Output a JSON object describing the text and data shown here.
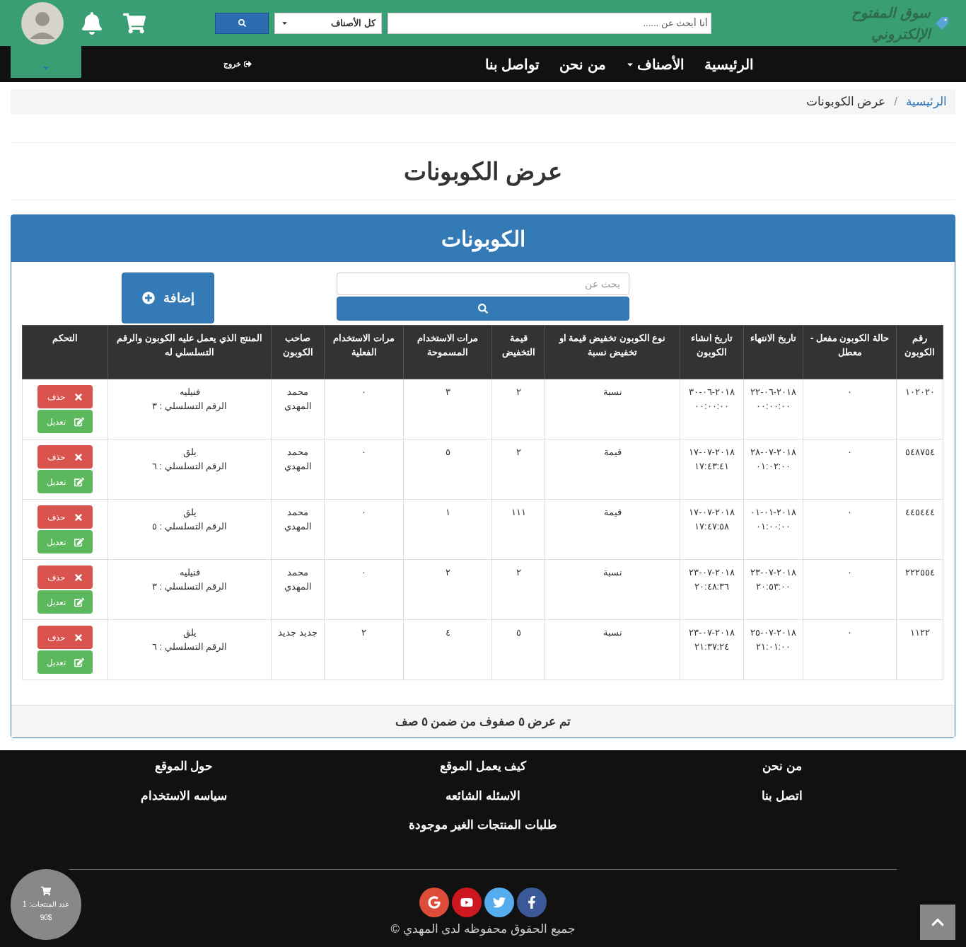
{
  "header": {
    "logo": "سوق المفتوح الإلكتروني",
    "search": {
      "placeholder": "أنا أبحث عن ......"
    },
    "category_select": {
      "value": "كل الأصناف"
    }
  },
  "nav": {
    "items": [
      {
        "label": "الرئيسية",
        "dropdown": false
      },
      {
        "label": "الأصناف",
        "dropdown": true
      },
      {
        "label": "من نحن",
        "dropdown": false
      },
      {
        "label": "تواصل بنا",
        "dropdown": false
      }
    ],
    "logout": "خروج"
  },
  "breadcrumb_separator": "/",
  "breadcrumb": [
    {
      "label": "الرئيسية",
      "selected": false
    },
    {
      "label": "عرض الكوبونات",
      "selected": true
    }
  ],
  "page_title": "عرض الكوبونات",
  "panel": {
    "title": "الكوبونات",
    "search": {
      "placeholder": "بحث عن"
    },
    "add_button": "إضافة",
    "table": {
      "columns": [
        "رقم الكوبون",
        "حالة الكوبون مفعل - معطل",
        "تاريخ الانتهاء",
        "تاريخ انشاء الكوبون",
        "نوع الكوبون تخفيض قيمة او تخفيض نسبة",
        "قيمة التخفيض",
        "مرات الاستخدام المسموحة",
        "مرات الاستخدام الفعلية",
        "صاحب الكوبون",
        "المنتج الذي يعمل عليه الكوبون والرقم التسلسلي له",
        "التحكم"
      ],
      "rows": [
        {
          "code": "١٠٢٠٢٠",
          "status": "٠",
          "expiry": [
            "٢٠١٨-٠٦-٢٢",
            "٠٠:٠٠:٠٠"
          ],
          "created": [
            "٢٠١٨-٠٦-٣٠",
            "٠٠:٠٠:٠٠"
          ],
          "type": "نسبة",
          "amount": "٢",
          "allowed": "٣",
          "used": "٠",
          "owner": "محمد المهدي",
          "product": [
            "فنيليه",
            "الرقم التسلسلي : ٣"
          ],
          "delete": "حذف",
          "edit": "تعديل"
        },
        {
          "code": "٥٤٨٧٥٤",
          "status": "٠",
          "expiry": [
            "٢٠١٨-٠٧-٢٨",
            "٠١:٠٢:٠٠"
          ],
          "created": [
            "٢٠١٨-٠٧-١٧",
            "١٧:٤٣:٤١"
          ],
          "type": "قيمة",
          "amount": "٢",
          "allowed": "٥",
          "used": "٠",
          "owner": "محمد المهدي",
          "product": [
            "يلق",
            "الرقم التسلسلي : ٦"
          ],
          "delete": "حذف",
          "edit": "تعديل"
        },
        {
          "code": "٤٤٥٤٤٤",
          "status": "٠",
          "expiry": [
            "٢٠١٨-٠١-٠١",
            "٠١:٠٠:٠٠"
          ],
          "created": [
            "٢٠١٨-٠٧-١٧",
            "١٧:٤٧:٥٨"
          ],
          "type": "قيمة",
          "amount": "١١١",
          "allowed": "١",
          "used": "٠",
          "owner": "محمد المهدي",
          "product": [
            "يلق",
            "الرقم التسلسلي : ٥"
          ],
          "delete": "حذف",
          "edit": "تعديل"
        },
        {
          "code": "٢٢٢٥٥٤",
          "status": "٠",
          "expiry": [
            "٢٠١٨-٠٧-٢٣",
            "٢٠:٥٣:٠٠"
          ],
          "created": [
            "٢٠١٨-٠٧-٢٣",
            "٢٠:٤٨:٣٦"
          ],
          "type": "نسبة",
          "amount": "٢",
          "allowed": "٢",
          "used": "٠",
          "owner": "محمد المهدي",
          "product": [
            "فنيليه",
            "الرقم التسلسلي : ٣"
          ],
          "delete": "حذف",
          "edit": "تعديل"
        },
        {
          "code": "١١٢٢",
          "status": "٠",
          "expiry": [
            "٢٠١٨-٠٧-٢٥",
            "٢١:٠١:٠٠"
          ],
          "created": [
            "٢٠١٨-٠٧-٢٣",
            "٢١:٣٧:٢٤"
          ],
          "type": "نسبة",
          "amount": "٥",
          "allowed": "٤",
          "used": "٢",
          "owner": "جديد جديد",
          "product": [
            "يلق",
            "الرقم التسلسلي : ٦"
          ],
          "delete": "حذف",
          "edit": "تعديل"
        }
      ]
    },
    "footer_text": "تم عرض ٥ صفوف من ضمن ٥ صف"
  },
  "footer": {
    "columns": [
      [
        "من نحن",
        "اتصل بنا"
      ],
      [
        "كيف يعمل الموقع",
        "الاسئله الشائعه",
        "طلبات المنتجات الغير موجودة"
      ],
      [
        "حول الموقع",
        "سياسه الاستخدام"
      ]
    ],
    "copyright": "جميع الحقوق محفوظه لدى المهدي ©"
  },
  "cart_widget": {
    "count_label": "عدد المنتجات:",
    "count": "1",
    "total": "90$"
  }
}
